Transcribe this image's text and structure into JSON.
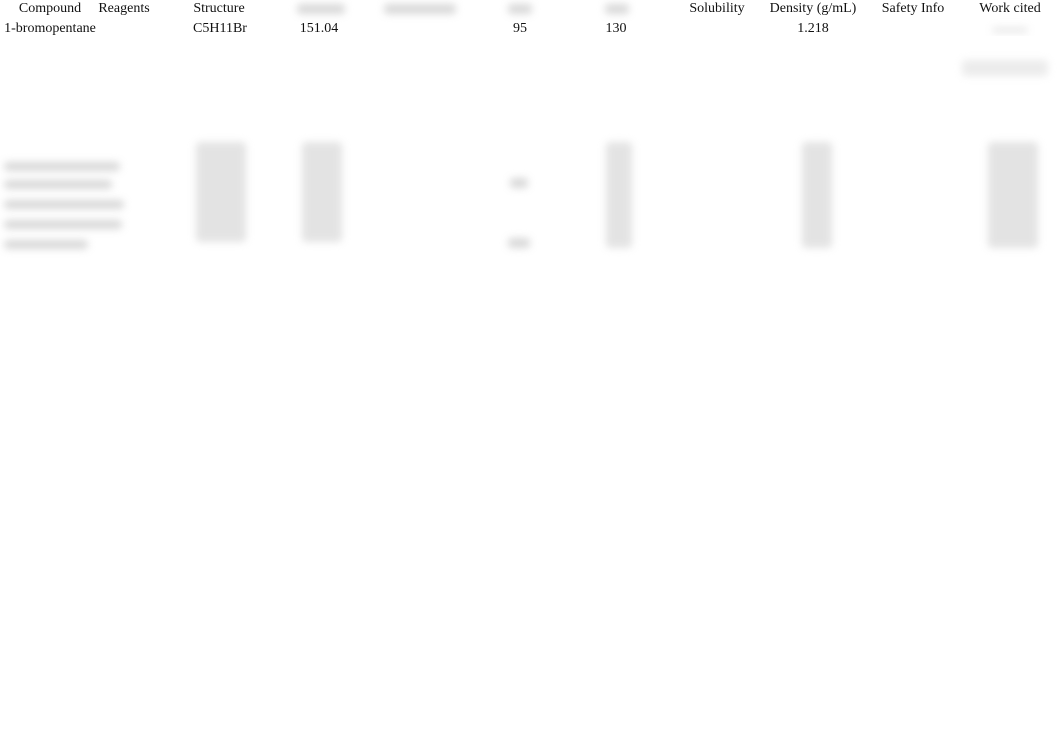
{
  "table": {
    "headers": [
      "Compound",
      "Reagents",
      "Structure",
      "",
      "",
      "",
      "",
      "Solubility",
      "Density (g/mL)",
      "Safety Info",
      "Work cited"
    ],
    "first_row": {
      "compound": "1-bromopentane",
      "structure": "C5H11Br",
      "molar_mass": "151.04",
      "col6": "95",
      "col7": "130",
      "density": "1.218"
    }
  }
}
